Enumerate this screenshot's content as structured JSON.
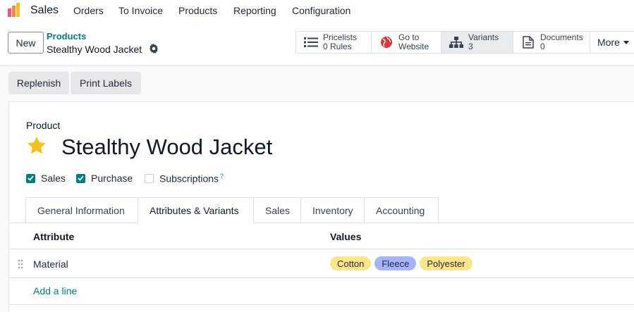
{
  "nav": {
    "app_name": "Sales",
    "menu": [
      "Orders",
      "To Invoice",
      "Products",
      "Reporting",
      "Configuration"
    ]
  },
  "control": {
    "new_label": "New",
    "breadcrumb": "Products",
    "record_title": "Stealthy Wood Jacket",
    "smart_buttons": [
      {
        "label": "Pricelists",
        "value": "0 Rules",
        "icon": "list-icon"
      },
      {
        "label": "Go to",
        "value": "Website",
        "icon": "globe-icon"
      },
      {
        "label": "Variants",
        "value": "3",
        "icon": "sitemap-icon"
      },
      {
        "label": "Documents",
        "value": "0",
        "icon": "document-icon"
      }
    ],
    "more_label": "More"
  },
  "actions": {
    "replenish": "Replenish",
    "print_labels": "Print Labels"
  },
  "form": {
    "product_label": "Product",
    "product_name": "Stealthy Wood Jacket",
    "favorite": true,
    "checkboxes": [
      {
        "label": "Sales",
        "checked": true
      },
      {
        "label": "Purchase",
        "checked": true
      },
      {
        "label": "Subscriptions",
        "checked": false,
        "help": "?"
      }
    ],
    "tabs": [
      "General Information",
      "Attributes & Variants",
      "Sales",
      "Inventory",
      "Accounting"
    ],
    "active_tab": "Attributes & Variants",
    "table": {
      "headers": [
        "Attribute",
        "Values"
      ],
      "rows": [
        {
          "attribute": "Material",
          "values": [
            "Cotton",
            "Fleece",
            "Polyester"
          ]
        }
      ],
      "add_line": "Add a line"
    }
  },
  "colors": {
    "accent": "#017e84",
    "tag_cotton": "#fde68a",
    "tag_fleece": "#a5b4fc",
    "tag_polyester": "#fde68a",
    "star": "#f3c31a"
  }
}
